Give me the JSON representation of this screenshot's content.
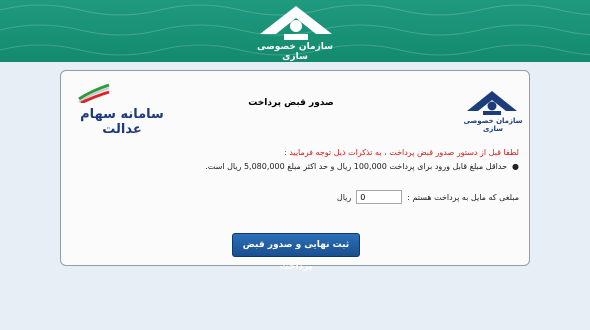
{
  "header": {
    "logo_icon": "privatization-org-logo-icon",
    "logo_text": "سازمان خصوصی سازی",
    "color": "#18917a"
  },
  "card": {
    "org_logo_icon": "privatization-org-logo-icon",
    "org_logo_text": "سازمان خصوصی سازی",
    "title": "صدور قبض پرداخت",
    "edalat_flag_icon": "iran-flag-ribbon-icon",
    "edalat_text": "سامانه سهام عدالت",
    "notice": "لطفا قبل از دستور صدور قبض پرداخت ، به تذکرات ذیل توجه فرمایید :",
    "bullet": "حداقل مبلغ قابل ورود برای پرداخت 100,000 ریال و حد اکثر مبلغ 5,080,000 ریال است.",
    "amount_label": "مبلغی که مایل به پرداخت هستم :",
    "amount_value": "0",
    "amount_unit": "ریال",
    "submit_label": "ثبت نهایی و صدور قبض پرداخت"
  },
  "colors": {
    "notice_red": "#d41b1b",
    "brand_blue": "#1d3a7c",
    "button_blue": "#1f5ea4"
  }
}
